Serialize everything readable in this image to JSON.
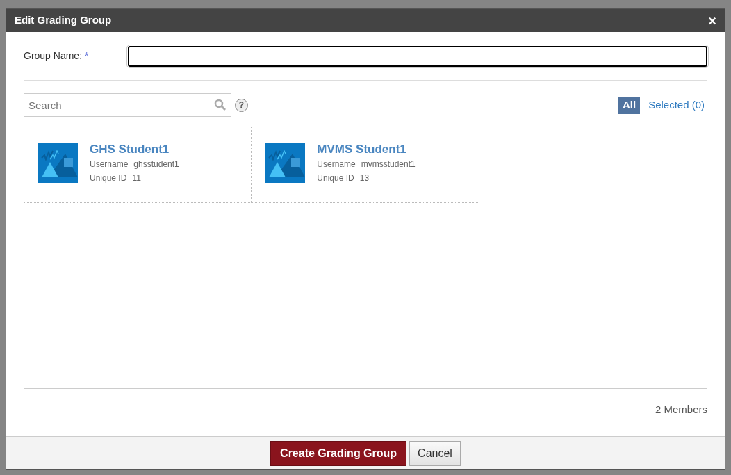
{
  "dialog": {
    "title": "Edit Grading Group",
    "close": "×"
  },
  "group_name": {
    "label": "Group Name:",
    "required_mark": "*"
  },
  "search": {
    "placeholder": "Search",
    "help": "?"
  },
  "filters": [
    {
      "label": "All",
      "selected": true
    },
    {
      "label": "Selected (0)",
      "selected": false
    }
  ],
  "members": [
    {
      "name": "GHS Student1",
      "username_label": "Username",
      "username": "ghsstudent1",
      "id_label": "Unique ID",
      "id": "11"
    },
    {
      "name": "MVMS Student1",
      "username_label": "Username",
      "username": "mvmsstudent1",
      "id_label": "Unique ID",
      "id": "13"
    }
  ],
  "member_count": "2 Members",
  "buttons": [
    {
      "label": "Create Grading Group",
      "kind": "primary"
    },
    {
      "label": "Cancel",
      "kind": "secondary"
    }
  ]
}
